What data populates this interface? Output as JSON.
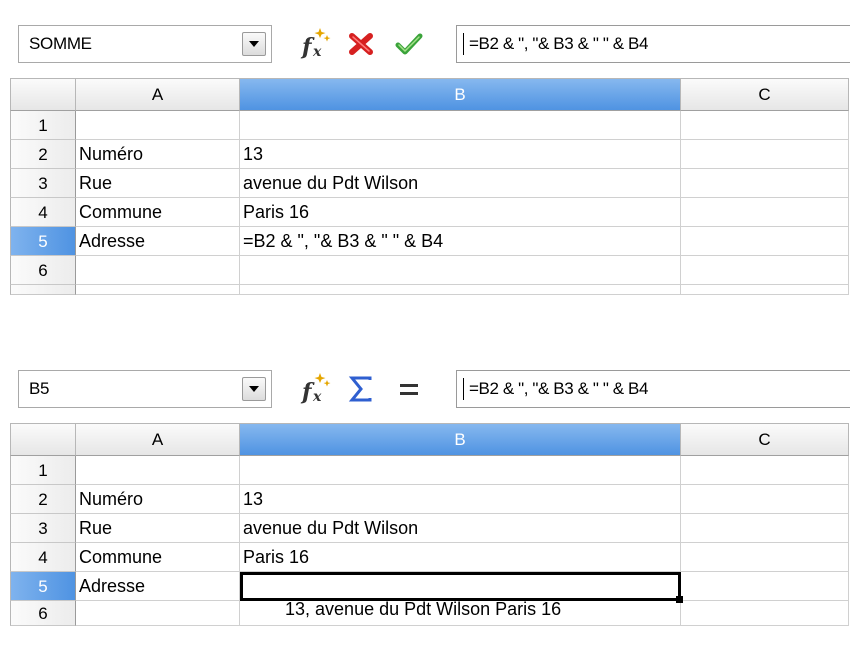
{
  "panels": [
    {
      "name_box": "SOMME",
      "formula_bar": "=B2 & \", \"& B3 & \" \" & B4",
      "toolbar_icons": [
        "function-wizard-icon",
        "cancel-icon",
        "accept-icon"
      ],
      "columns": [
        "A",
        "B",
        "C"
      ],
      "rows": [
        {
          "num": "1",
          "a": "",
          "b": ""
        },
        {
          "num": "2",
          "a": "Numéro",
          "b": "13"
        },
        {
          "num": "3",
          "a": "Rue",
          "b": "avenue du Pdt Wilson"
        },
        {
          "num": "4",
          "a": "Commune",
          "b": "Paris 16"
        },
        {
          "num": "5",
          "a": "Adresse",
          "b": "=B2 & \", \"& B3 & \" \" & B4"
        },
        {
          "num": "6",
          "a": "",
          "b": ""
        }
      ]
    },
    {
      "name_box": "B5",
      "formula_bar": "=B2 & \", \"& B3 & \" \" & B4",
      "toolbar_icons": [
        "function-wizard-icon",
        "sum-icon",
        "equals-icon"
      ],
      "columns": [
        "A",
        "B",
        "C"
      ],
      "rows": [
        {
          "num": "1",
          "a": "",
          "b": ""
        },
        {
          "num": "2",
          "a": "Numéro",
          "b": "13"
        },
        {
          "num": "3",
          "a": "Rue",
          "b": "avenue du Pdt Wilson"
        },
        {
          "num": "4",
          "a": "Commune",
          "b": "Paris 16"
        },
        {
          "num": "5",
          "a": "Adresse",
          "b": "13, avenue du Pdt Wilson Paris 16"
        },
        {
          "num": "6",
          "a": "",
          "b": ""
        }
      ]
    }
  ],
  "colors": {
    "selected_header": "#4f93e2",
    "cancel": "#d62020",
    "accept": "#3aa33a",
    "sum": "#2f5fd0"
  }
}
